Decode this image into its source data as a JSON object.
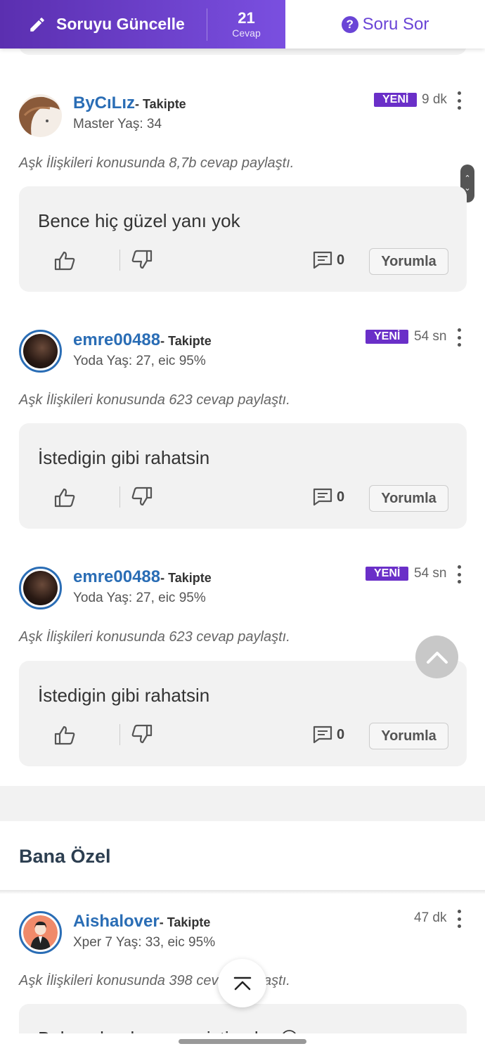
{
  "topbar": {
    "update_label": "Soruyu Güncelle",
    "answer_count": "21",
    "answer_count_label": "Cevap",
    "ask_label": "Soru Sor"
  },
  "answers": [
    {
      "username": "ByCıLız",
      "follow": "- Takipte",
      "level": "Master Yaş: 34",
      "badge": "YENİ",
      "time": "9 dk",
      "topic": "Aşk İlişkileri konusunda 8,7b cevap paylaştı.",
      "text": "Bence hiç güzel yanı yok",
      "comments": "0",
      "comment_button": "Yorumla"
    },
    {
      "username": "emre00488",
      "follow": "- Takipte",
      "level": "Yoda Yaş: 27, eic 95%",
      "badge": "YENİ",
      "time": "54 sn",
      "topic": "Aşk İlişkileri konusunda 623 cevap paylaştı.",
      "text": "İstedigin gibi rahatsin",
      "comments": "0",
      "comment_button": "Yorumla"
    },
    {
      "username": "emre00488",
      "follow": "- Takipte",
      "level": "Yoda Yaş: 27, eic 95%",
      "badge": "YENİ",
      "time": "54 sn",
      "topic": "Aşk İlişkileri konusunda 623 cevap paylaştı.",
      "text": "İstedigin gibi rahatsin",
      "comments": "0",
      "comment_button": "Yorumla"
    }
  ],
  "special": {
    "title": "Bana Özel",
    "answer": {
      "username": "Aishalover",
      "follow": "- Takipte",
      "level": "Xper 7 Yaş: 33, eic 95%",
      "time": "47 dk",
      "topic": "Aşk İlişkileri konusunda 398 cevap paylaştı.",
      "text_partial": "Bakma bunlar ne ne istiyorlar 😊"
    }
  },
  "colors": {
    "brand_purple": "#6a2fc8",
    "link_blue": "#2a6db5"
  }
}
